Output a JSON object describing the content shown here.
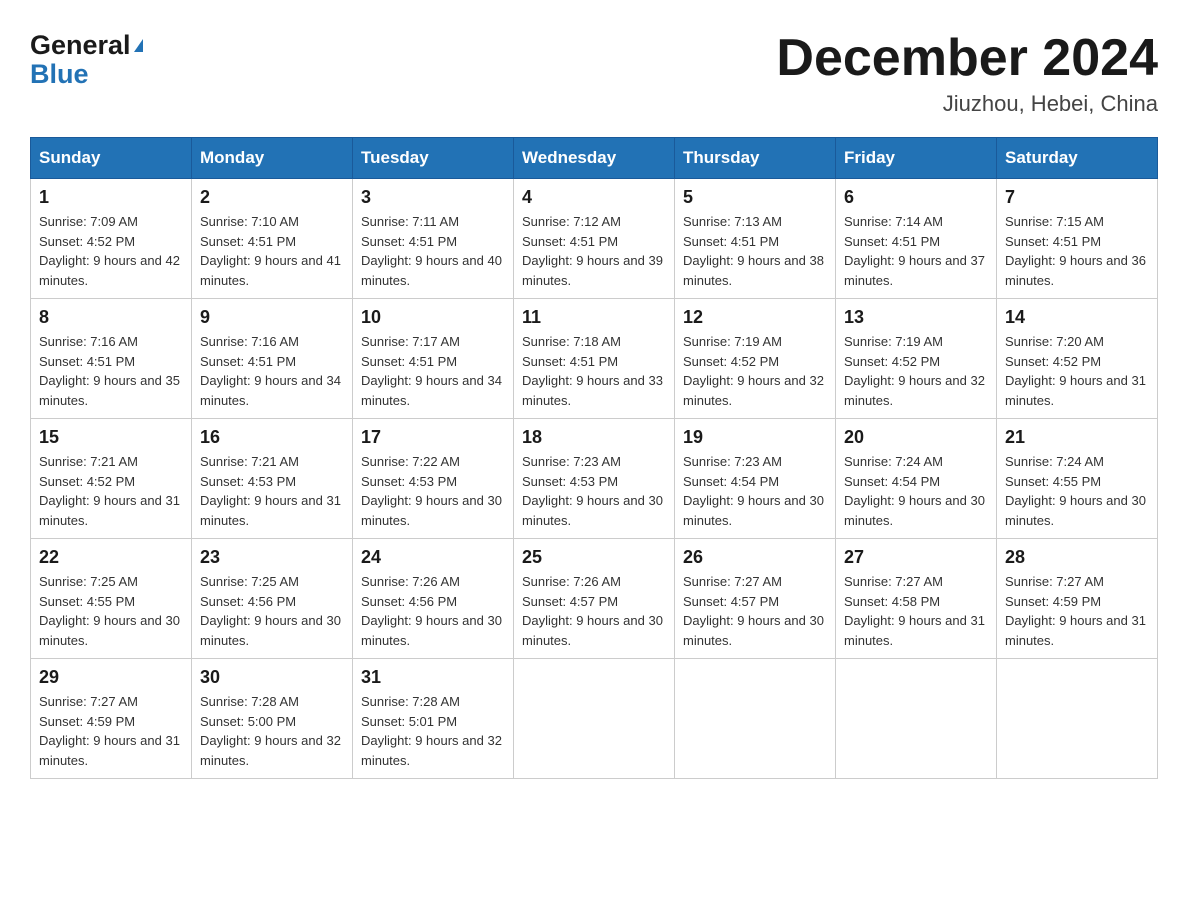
{
  "header": {
    "logo": {
      "general": "General",
      "triangle_char": "▶",
      "blue": "Blue"
    },
    "title": "December 2024",
    "subtitle": "Jiuzhou, Hebei, China"
  },
  "calendar": {
    "headers": [
      "Sunday",
      "Monday",
      "Tuesday",
      "Wednesday",
      "Thursday",
      "Friday",
      "Saturday"
    ],
    "weeks": [
      [
        {
          "day": "1",
          "sunrise": "Sunrise: 7:09 AM",
          "sunset": "Sunset: 4:52 PM",
          "daylight": "Daylight: 9 hours and 42 minutes."
        },
        {
          "day": "2",
          "sunrise": "Sunrise: 7:10 AM",
          "sunset": "Sunset: 4:51 PM",
          "daylight": "Daylight: 9 hours and 41 minutes."
        },
        {
          "day": "3",
          "sunrise": "Sunrise: 7:11 AM",
          "sunset": "Sunset: 4:51 PM",
          "daylight": "Daylight: 9 hours and 40 minutes."
        },
        {
          "day": "4",
          "sunrise": "Sunrise: 7:12 AM",
          "sunset": "Sunset: 4:51 PM",
          "daylight": "Daylight: 9 hours and 39 minutes."
        },
        {
          "day": "5",
          "sunrise": "Sunrise: 7:13 AM",
          "sunset": "Sunset: 4:51 PM",
          "daylight": "Daylight: 9 hours and 38 minutes."
        },
        {
          "day": "6",
          "sunrise": "Sunrise: 7:14 AM",
          "sunset": "Sunset: 4:51 PM",
          "daylight": "Daylight: 9 hours and 37 minutes."
        },
        {
          "day": "7",
          "sunrise": "Sunrise: 7:15 AM",
          "sunset": "Sunset: 4:51 PM",
          "daylight": "Daylight: 9 hours and 36 minutes."
        }
      ],
      [
        {
          "day": "8",
          "sunrise": "Sunrise: 7:16 AM",
          "sunset": "Sunset: 4:51 PM",
          "daylight": "Daylight: 9 hours and 35 minutes."
        },
        {
          "day": "9",
          "sunrise": "Sunrise: 7:16 AM",
          "sunset": "Sunset: 4:51 PM",
          "daylight": "Daylight: 9 hours and 34 minutes."
        },
        {
          "day": "10",
          "sunrise": "Sunrise: 7:17 AM",
          "sunset": "Sunset: 4:51 PM",
          "daylight": "Daylight: 9 hours and 34 minutes."
        },
        {
          "day": "11",
          "sunrise": "Sunrise: 7:18 AM",
          "sunset": "Sunset: 4:51 PM",
          "daylight": "Daylight: 9 hours and 33 minutes."
        },
        {
          "day": "12",
          "sunrise": "Sunrise: 7:19 AM",
          "sunset": "Sunset: 4:52 PM",
          "daylight": "Daylight: 9 hours and 32 minutes."
        },
        {
          "day": "13",
          "sunrise": "Sunrise: 7:19 AM",
          "sunset": "Sunset: 4:52 PM",
          "daylight": "Daylight: 9 hours and 32 minutes."
        },
        {
          "day": "14",
          "sunrise": "Sunrise: 7:20 AM",
          "sunset": "Sunset: 4:52 PM",
          "daylight": "Daylight: 9 hours and 31 minutes."
        }
      ],
      [
        {
          "day": "15",
          "sunrise": "Sunrise: 7:21 AM",
          "sunset": "Sunset: 4:52 PM",
          "daylight": "Daylight: 9 hours and 31 minutes."
        },
        {
          "day": "16",
          "sunrise": "Sunrise: 7:21 AM",
          "sunset": "Sunset: 4:53 PM",
          "daylight": "Daylight: 9 hours and 31 minutes."
        },
        {
          "day": "17",
          "sunrise": "Sunrise: 7:22 AM",
          "sunset": "Sunset: 4:53 PM",
          "daylight": "Daylight: 9 hours and 30 minutes."
        },
        {
          "day": "18",
          "sunrise": "Sunrise: 7:23 AM",
          "sunset": "Sunset: 4:53 PM",
          "daylight": "Daylight: 9 hours and 30 minutes."
        },
        {
          "day": "19",
          "sunrise": "Sunrise: 7:23 AM",
          "sunset": "Sunset: 4:54 PM",
          "daylight": "Daylight: 9 hours and 30 minutes."
        },
        {
          "day": "20",
          "sunrise": "Sunrise: 7:24 AM",
          "sunset": "Sunset: 4:54 PM",
          "daylight": "Daylight: 9 hours and 30 minutes."
        },
        {
          "day": "21",
          "sunrise": "Sunrise: 7:24 AM",
          "sunset": "Sunset: 4:55 PM",
          "daylight": "Daylight: 9 hours and 30 minutes."
        }
      ],
      [
        {
          "day": "22",
          "sunrise": "Sunrise: 7:25 AM",
          "sunset": "Sunset: 4:55 PM",
          "daylight": "Daylight: 9 hours and 30 minutes."
        },
        {
          "day": "23",
          "sunrise": "Sunrise: 7:25 AM",
          "sunset": "Sunset: 4:56 PM",
          "daylight": "Daylight: 9 hours and 30 minutes."
        },
        {
          "day": "24",
          "sunrise": "Sunrise: 7:26 AM",
          "sunset": "Sunset: 4:56 PM",
          "daylight": "Daylight: 9 hours and 30 minutes."
        },
        {
          "day": "25",
          "sunrise": "Sunrise: 7:26 AM",
          "sunset": "Sunset: 4:57 PM",
          "daylight": "Daylight: 9 hours and 30 minutes."
        },
        {
          "day": "26",
          "sunrise": "Sunrise: 7:27 AM",
          "sunset": "Sunset: 4:57 PM",
          "daylight": "Daylight: 9 hours and 30 minutes."
        },
        {
          "day": "27",
          "sunrise": "Sunrise: 7:27 AM",
          "sunset": "Sunset: 4:58 PM",
          "daylight": "Daylight: 9 hours and 31 minutes."
        },
        {
          "day": "28",
          "sunrise": "Sunrise: 7:27 AM",
          "sunset": "Sunset: 4:59 PM",
          "daylight": "Daylight: 9 hours and 31 minutes."
        }
      ],
      [
        {
          "day": "29",
          "sunrise": "Sunrise: 7:27 AM",
          "sunset": "Sunset: 4:59 PM",
          "daylight": "Daylight: 9 hours and 31 minutes."
        },
        {
          "day": "30",
          "sunrise": "Sunrise: 7:28 AM",
          "sunset": "Sunset: 5:00 PM",
          "daylight": "Daylight: 9 hours and 32 minutes."
        },
        {
          "day": "31",
          "sunrise": "Sunrise: 7:28 AM",
          "sunset": "Sunset: 5:01 PM",
          "daylight": "Daylight: 9 hours and 32 minutes."
        },
        null,
        null,
        null,
        null
      ]
    ]
  }
}
